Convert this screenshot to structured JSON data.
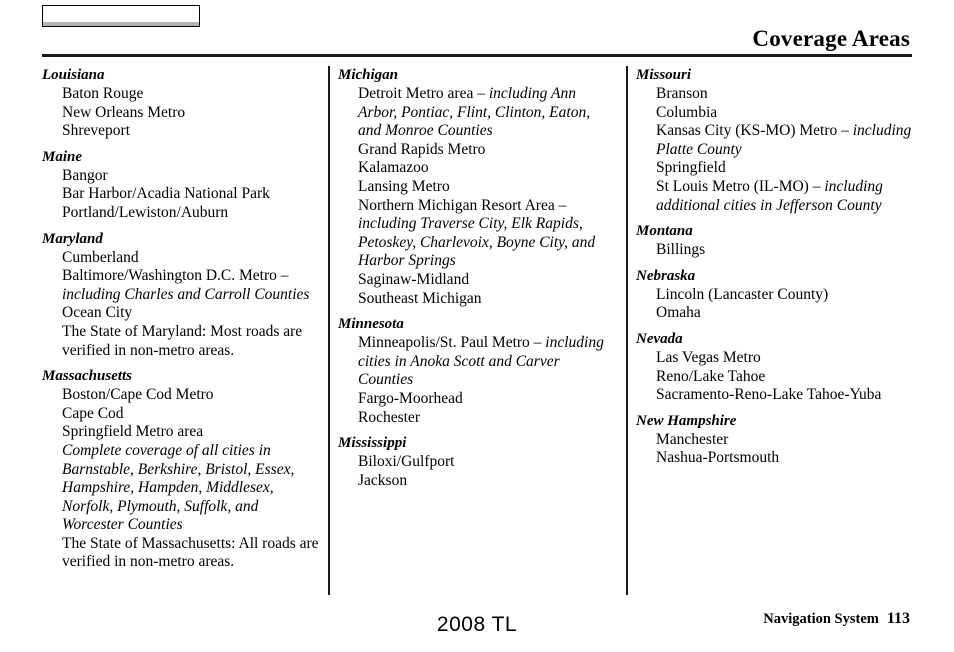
{
  "header": {
    "tab_label": "",
    "title": "Coverage Areas"
  },
  "footer": {
    "model_year": "2008  TL",
    "manual_name": "Navigation System",
    "page_number": "113"
  },
  "columns": [
    {
      "id": "column-1",
      "states": [
        {
          "name": "Louisiana",
          "items": [
            {
              "text": "Baton Rouge",
              "style": "roman"
            },
            {
              "text": "New Orleans Metro",
              "style": "roman"
            },
            {
              "text": "Shreveport",
              "style": "roman"
            }
          ]
        },
        {
          "name": "Maine",
          "items": [
            {
              "text": "Bangor",
              "style": "roman"
            },
            {
              "text": "Bar Harbor/Acadia National Park",
              "style": "roman"
            },
            {
              "text": "Portland/Lewiston/Auburn",
              "style": "roman"
            }
          ]
        },
        {
          "name": "Maryland",
          "items": [
            {
              "text": "Cumberland",
              "style": "roman"
            },
            {
              "text": "Baltimore/Washington D.C. Metro – ",
              "style": "mixed",
              "italic_tail": "including Charles and Carroll Counties"
            },
            {
              "text": "Ocean City",
              "style": "roman"
            },
            {
              "text": "The State of Maryland: Most roads are verified in non-metro areas.",
              "style": "roman"
            }
          ]
        },
        {
          "name": "Massachusetts",
          "items": [
            {
              "text": "Boston/Cape Cod Metro",
              "style": "roman"
            },
            {
              "text": "Cape Cod",
              "style": "roman"
            },
            {
              "text": "Springfield Metro area",
              "style": "roman"
            },
            {
              "text": "Complete coverage of all cities in Barnstable, Berkshire, Bristol, Essex, Hampshire, Hampden, Middlesex, Norfolk, Plymouth, Suffolk, and Worcester Counties",
              "style": "italic"
            },
            {
              "text": "The State of Massachusetts: All roads are verified in non-metro areas.",
              "style": "roman"
            }
          ]
        }
      ]
    },
    {
      "id": "column-2",
      "states": [
        {
          "name": "Michigan",
          "items": [
            {
              "text": "Detroit Metro area – ",
              "style": "mixed",
              "italic_tail": "including Ann Arbor, Pontiac, Flint, Clinton, Eaton, and Monroe Counties"
            },
            {
              "text": "Grand Rapids Metro",
              "style": "roman"
            },
            {
              "text": "Kalamazoo",
              "style": "roman"
            },
            {
              "text": "Lansing Metro",
              "style": "roman"
            },
            {
              "text": "Northern Michigan Resort Area – ",
              "style": "mixed",
              "italic_tail": "including Traverse City, Elk Rapids, Petoskey, Charlevoix, Boyne City, and Harbor Springs"
            },
            {
              "text": "Saginaw-Midland",
              "style": "roman"
            },
            {
              "text": "Southeast Michigan",
              "style": "roman"
            }
          ]
        },
        {
          "name": "Minnesota",
          "items": [
            {
              "text": "Minneapolis/St. Paul Metro – ",
              "style": "mixed",
              "italic_tail": "including cities in Anoka Scott and Carver Counties"
            },
            {
              "text": "Fargo-Moorhead",
              "style": "roman"
            },
            {
              "text": "Rochester",
              "style": "roman"
            }
          ]
        },
        {
          "name": "Mississippi",
          "items": [
            {
              "text": "Biloxi/Gulfport",
              "style": "roman"
            },
            {
              "text": "Jackson",
              "style": "roman"
            }
          ]
        }
      ]
    },
    {
      "id": "column-3",
      "states": [
        {
          "name": "Missouri",
          "items": [
            {
              "text": "Branson",
              "style": "roman"
            },
            {
              "text": "Columbia",
              "style": "roman"
            },
            {
              "text": "Kansas City (KS-MO) Metro – ",
              "style": "mixed",
              "italic_tail": "including Platte County"
            },
            {
              "text": "Springfield",
              "style": "roman"
            },
            {
              "text": "St Louis Metro (IL-MO) – ",
              "style": "mixed",
              "italic_tail": "including additional cities in Jefferson County"
            }
          ]
        },
        {
          "name": "Montana",
          "items": [
            {
              "text": "Billings",
              "style": "roman"
            }
          ]
        },
        {
          "name": "Nebraska",
          "items": [
            {
              "text": "Lincoln (Lancaster County)",
              "style": "roman"
            },
            {
              "text": "Omaha",
              "style": "roman"
            }
          ]
        },
        {
          "name": "Nevada",
          "items": [
            {
              "text": "Las Vegas Metro",
              "style": "roman"
            },
            {
              "text": "Reno/Lake Tahoe",
              "style": "roman"
            },
            {
              "text": "Sacramento-Reno-Lake Tahoe-Yuba",
              "style": "roman"
            }
          ]
        },
        {
          "name": "New Hampshire",
          "items": [
            {
              "text": "Manchester",
              "style": "roman"
            },
            {
              "text": "Nashua-Portsmouth",
              "style": "roman"
            }
          ]
        }
      ]
    }
  ]
}
